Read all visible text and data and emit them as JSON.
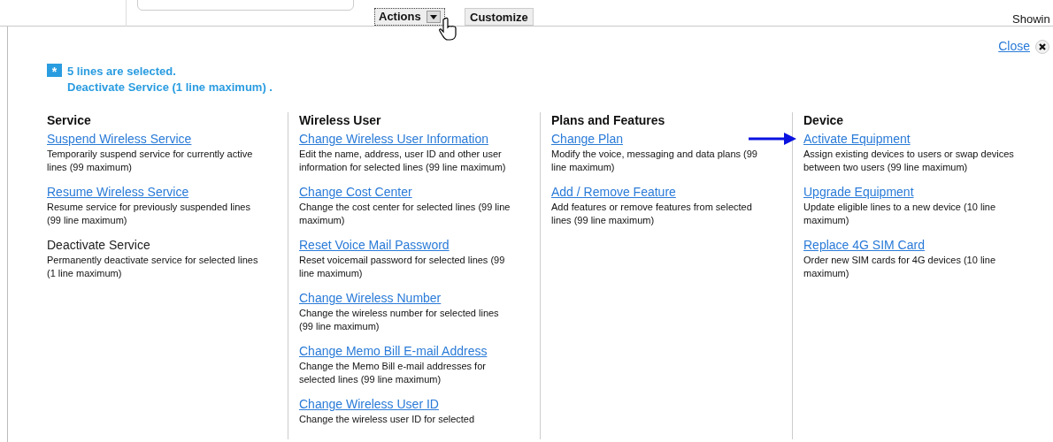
{
  "toolbar": {
    "actions_button": "Actions",
    "customize_button": "Customize",
    "showing_text": "Showin"
  },
  "panel": {
    "close_link": "Close",
    "notice": {
      "icon": "*",
      "lines": [
        "5 lines are selected.",
        "Deactivate Service (1 line maximum) ."
      ]
    },
    "columns": [
      {
        "heading": "Service",
        "items": [
          {
            "title": "Suspend Wireless Service",
            "description": "Temporarily suspend service for currently active lines (99 maximum)",
            "disabled": false,
            "arrow": false
          },
          {
            "title": "Resume Wireless Service",
            "description": "Resume service for previously suspended lines (99 line maximum)",
            "disabled": false,
            "arrow": false
          },
          {
            "title": "Deactivate Service",
            "description": "Permanently deactivate service for selected lines (1 line maximum)",
            "disabled": true,
            "arrow": false
          }
        ]
      },
      {
        "heading": "Wireless User",
        "items": [
          {
            "title": "Change Wireless User Information",
            "description": "Edit the name, address, user ID and other user information for selected lines (99 line maximum)",
            "disabled": false,
            "arrow": false
          },
          {
            "title": "Change Cost Center",
            "description": "Change the cost center for selected lines (99 line maximum)",
            "disabled": false,
            "arrow": false
          },
          {
            "title": "Reset Voice Mail Password",
            "description": "Reset voicemail password for selected lines (99 line maximum)",
            "disabled": false,
            "arrow": false
          },
          {
            "title": "Change Wireless Number",
            "description": "Change the wireless number for selected lines (99 line maximum)",
            "disabled": false,
            "arrow": false
          },
          {
            "title": "Change Memo Bill E-mail Address",
            "description": "Change the Memo Bill e-mail addresses for selected lines (99 line maximum)",
            "disabled": false,
            "arrow": false
          },
          {
            "title": "Change Wireless User ID",
            "description": "Change the wireless user ID for selected",
            "disabled": false,
            "arrow": false
          }
        ]
      },
      {
        "heading": "Plans and Features",
        "items": [
          {
            "title": "Change Plan",
            "description": "Modify the voice, messaging and data plans (99 line maximum)",
            "disabled": false,
            "arrow": false
          },
          {
            "title": "Add / Remove Feature",
            "description": "Add features or remove features from selected lines (99 line maximum)",
            "disabled": false,
            "arrow": false
          }
        ]
      },
      {
        "heading": "Device",
        "items": [
          {
            "title": "Activate Equipment",
            "description": "Assign existing devices to users or swap devices between two users (99 line maximum)",
            "disabled": false,
            "arrow": true
          },
          {
            "title": "Upgrade Equipment",
            "description": "Update eligible lines to a new device (10 line maximum)",
            "disabled": false,
            "arrow": false
          },
          {
            "title": "Replace 4G SIM Card",
            "description": "Order new SIM cards for 4G devices (10 line maximum)",
            "disabled": false,
            "arrow": false
          }
        ]
      }
    ]
  }
}
